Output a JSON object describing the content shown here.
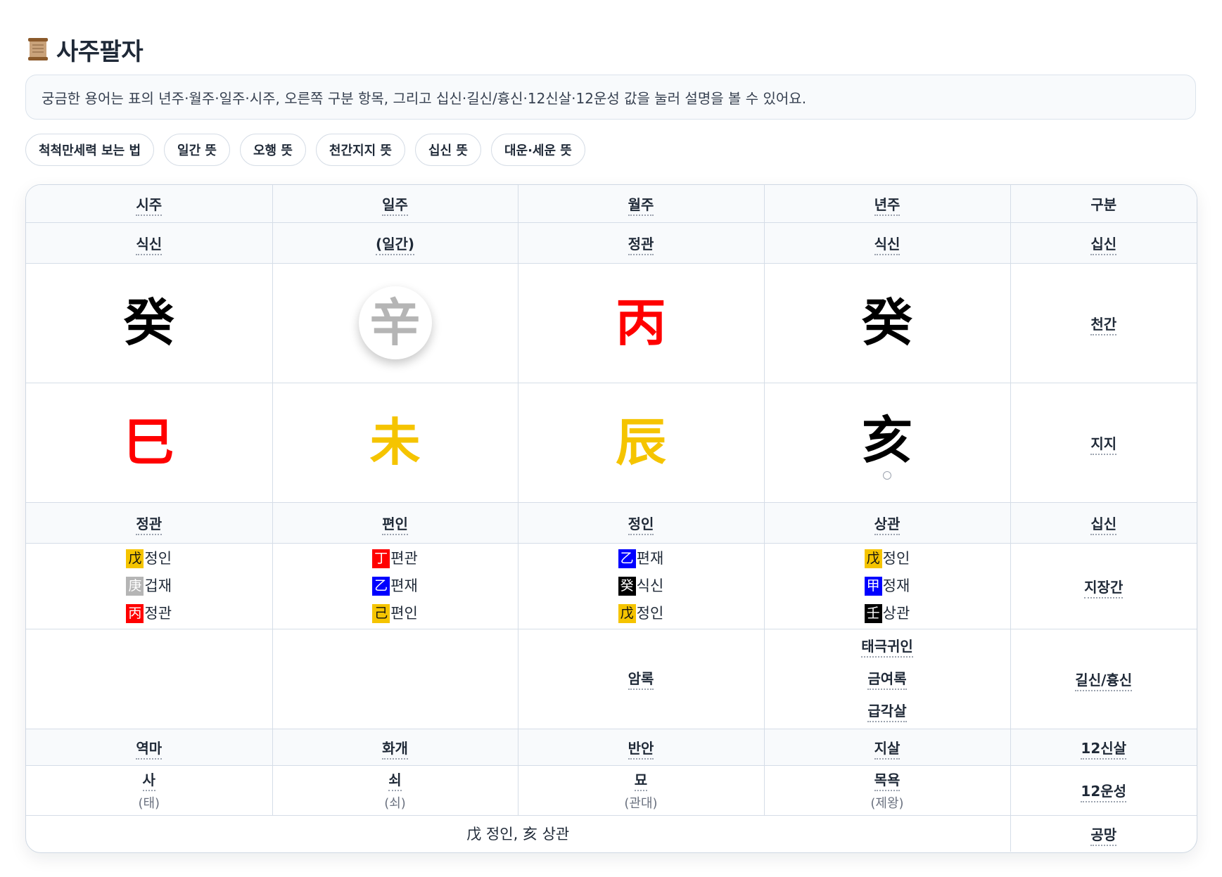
{
  "header": {
    "title": "사주팔자",
    "info": "궁금한 용어는 표의 년주·월주·일주·시주, 오른쪽 구분 항목, 그리고 십신·길신/흉신·12신살·12운성 값을 눌러 설명을 볼 수 있어요."
  },
  "chips": [
    "척척만세력 보는 법",
    "일간 뜻",
    "오행 뜻",
    "천간지지 뜻",
    "십신 뜻",
    "대운·세운 뜻"
  ],
  "columns": [
    "시주",
    "일주",
    "월주",
    "년주",
    "구분"
  ],
  "ten_gods_top": [
    "식신",
    "(일간)",
    "정관",
    "식신"
  ],
  "heavenly_stems": [
    {
      "char": "癸",
      "color": "#000000"
    },
    {
      "char": "辛",
      "color": "#b5b5b5"
    },
    {
      "char": "丙",
      "color": "#ff0000"
    },
    {
      "char": "癸",
      "color": "#000000"
    }
  ],
  "earthly_branches": [
    {
      "char": "巳",
      "color": "#ff0000"
    },
    {
      "char": "未",
      "color": "#f5c400"
    },
    {
      "char": "辰",
      "color": "#f5c400"
    },
    {
      "char": "亥",
      "color": "#000000"
    }
  ],
  "ten_gods_bottom": [
    "정관",
    "편인",
    "정인",
    "상관"
  ],
  "hidden_stems": [
    [
      {
        "h": "戊",
        "c": "yellow",
        "t": "정인"
      },
      {
        "h": "庚",
        "c": "gray",
        "t": "겁재"
      },
      {
        "h": "丙",
        "c": "red",
        "t": "정관"
      }
    ],
    [
      {
        "h": "丁",
        "c": "red",
        "t": "편관"
      },
      {
        "h": "乙",
        "c": "blue",
        "t": "편재"
      },
      {
        "h": "己",
        "c": "yellow",
        "t": "편인"
      }
    ],
    [
      {
        "h": "乙",
        "c": "blue",
        "t": "편재"
      },
      {
        "h": "癸",
        "c": "black",
        "t": "식신"
      },
      {
        "h": "戊",
        "c": "yellow",
        "t": "정인"
      }
    ],
    [
      {
        "h": "戊",
        "c": "yellow",
        "t": "정인"
      },
      {
        "h": "甲",
        "c": "blue",
        "t": "정재"
      },
      {
        "h": "壬",
        "c": "black",
        "t": "상관"
      }
    ]
  ],
  "gilsin": [
    [],
    [],
    [
      "암록"
    ],
    [
      "태극귀인",
      "금여록",
      "급각살"
    ]
  ],
  "sinsal12": [
    "역마",
    "화개",
    "반안",
    "지살"
  ],
  "unseong12": [
    {
      "main": "사",
      "sub": "(태)"
    },
    {
      "main": "쇠",
      "sub": "(쇠)"
    },
    {
      "main": "묘",
      "sub": "(관대)"
    },
    {
      "main": "목욕",
      "sub": "(제왕)"
    }
  ],
  "gongmang": "戊 정인, 亥 상관",
  "row_labels": {
    "ten_gods_top": "십신",
    "heavenly": "천간",
    "earthly": "지지",
    "ten_gods_bottom": "십신",
    "hidden": "지장간",
    "gilsin": "길신/흉신",
    "sinsal": "12신살",
    "unseong": "12운성",
    "gongmang": "공망"
  }
}
